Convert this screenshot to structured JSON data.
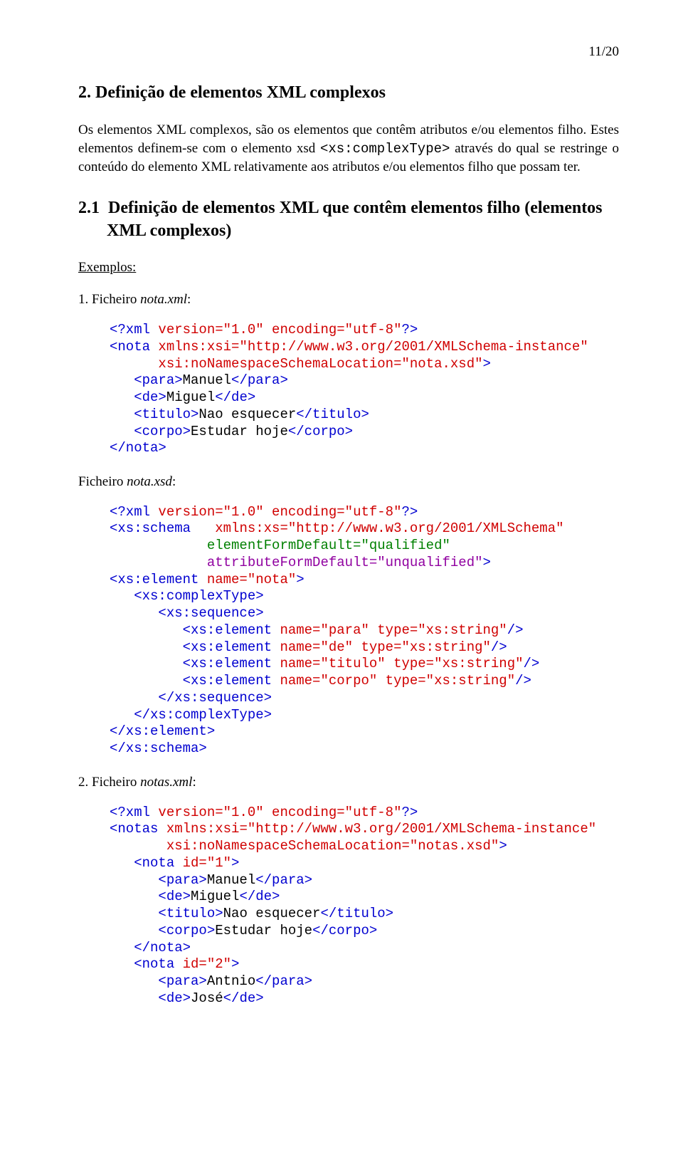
{
  "page_number": "11/20",
  "section": {
    "heading": "2. Definição de elementos XML complexos",
    "para1_a": "Os elementos XML complexos, são os elementos que contêm atributos e/ou elementos filho. Estes elementos definem-se com o elemento xsd ",
    "para1_code": "<xs:complexType>",
    "para1_b": " através do qual se restringe o conteúdo do elemento XML relativamente aos atributos e/ou elementos filho que possam ter."
  },
  "subsection": {
    "number": "2.1",
    "title": "Definição de elementos XML que contêm elementos filho (elementos XML complexos)",
    "examples_label": "Exemplos:"
  },
  "ex1": {
    "head_pre": "1. Ficheiro ",
    "head_it": "nota.xml",
    "head_post": ":",
    "xml": {
      "decl_a": "<?xml ",
      "decl_b": "version=\"1.0\" encoding=\"utf-8\"",
      "decl_c": "?>",
      "l2a": "<nota ",
      "l2b": "xmlns:xsi=\"http://www.w3.org/2001/XMLSchema-instance\"",
      "l3a": "      ",
      "l3b": "xsi:noNamespaceSchemaLocation=\"nota.xsd\"",
      "l3c": ">",
      "l4a": "   <para>",
      "l4b": "Manuel",
      "l4c": "</para>",
      "l5a": "   <de>",
      "l5b": "Miguel",
      "l5c": "</de>",
      "l6a": "   <titulo>",
      "l6b": "Nao esquecer",
      "l6c": "</titulo>",
      "l7a": "   <corpo>",
      "l7b": "Estudar hoje",
      "l7c": "</corpo>",
      "l8": "</nota>"
    },
    "xsd_head_pre": "Ficheiro ",
    "xsd_head_it": "nota.xsd",
    "xsd_head_post": ":",
    "xsd": {
      "decl_a": "<?xml ",
      "decl_b": "version=\"1.0\" encoding=\"utf-8\"",
      "decl_c": "?>",
      "l2a": "<xs:schema   ",
      "l2b": "xmlns:xs=\"http://www.w3.org/2001/XMLSchema\"",
      "l3a": "            ",
      "l3b": "elementFormDefault=\"qualified\"",
      "l4a": "            ",
      "l4b": "attributeFormDefault=\"unqualified\"",
      "l4c": ">",
      "l5a": "<xs:element ",
      "l5b": "name=\"nota\"",
      "l5c": ">",
      "l6": "   <xs:complexType>",
      "l7": "      <xs:sequence>",
      "l8a": "         <xs:element ",
      "l8b": "name=\"para\" type=\"xs:string\"",
      "l8c": "/>",
      "l9a": "         <xs:element ",
      "l9b": "name=\"de\" type=\"xs:string\"",
      "l9c": "/>",
      "l10a": "         <xs:element ",
      "l10b": "name=\"titulo\" type=\"xs:string\"",
      "l10c": "/>",
      "l11a": "         <xs:element ",
      "l11b": "name=\"corpo\" type=\"xs:string\"",
      "l11c": "/>",
      "l12": "      </xs:sequence>",
      "l13": "   </xs:complexType>",
      "l14": "</xs:element>",
      "l15": "</xs:schema>"
    }
  },
  "ex2": {
    "head_pre": "2. Ficheiro ",
    "head_it": "notas.xml",
    "head_post": ":",
    "xml": {
      "decl_a": "<?xml ",
      "decl_b": "version=\"1.0\" encoding=\"utf-8\"",
      "decl_c": "?>",
      "l2a": "<notas ",
      "l2b": "xmlns:xsi=\"http://www.w3.org/2001/XMLSchema-instance\"",
      "l3a": "       ",
      "l3b": "xsi:noNamespaceSchemaLocation=\"notas.xsd\"",
      "l3c": ">",
      "l4a": "   <nota ",
      "l4b": "id=\"1\"",
      "l4c": ">",
      "l5a": "      <para>",
      "l5b": "Manuel",
      "l5c": "</para>",
      "l6a": "      <de>",
      "l6b": "Miguel",
      "l6c": "</de>",
      "l7a": "      <titulo>",
      "l7b": "Nao esquecer",
      "l7c": "</titulo>",
      "l8a": "      <corpo>",
      "l8b": "Estudar hoje",
      "l8c": "</corpo>",
      "l9": "   </nota>",
      "l10a": "   <nota ",
      "l10b": "id=\"2\"",
      "l10c": ">",
      "l11a": "      <para>",
      "l11b": "Antnio",
      "l11c": "</para>",
      "l12a": "      <de>",
      "l12b": "José",
      "l12c": "</de>"
    }
  }
}
